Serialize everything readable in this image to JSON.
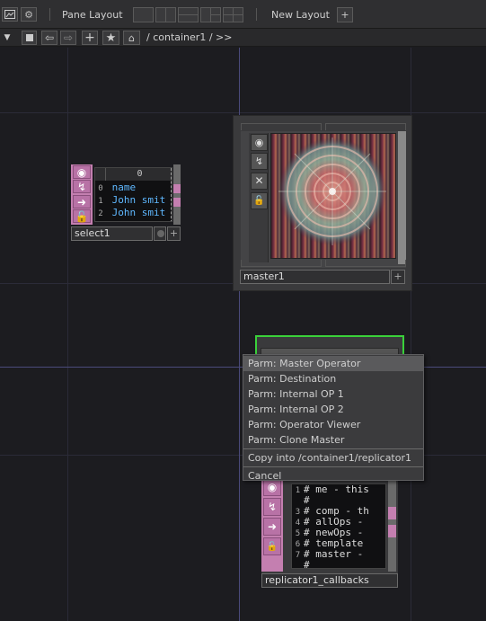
{
  "toolbar": {
    "pane_layout_label": "Pane Layout",
    "new_layout_label": "New Layout",
    "add_symbol": "+"
  },
  "pathbar": {
    "path_text": "/ container1 / >>"
  },
  "nodes": {
    "select1": {
      "name": "select1",
      "table": {
        "header": "0",
        "rows": [
          {
            "index": "0",
            "value": "name"
          },
          {
            "index": "1",
            "value": "John smit"
          },
          {
            "index": "2",
            "value": "John smit"
          }
        ]
      }
    },
    "master1": {
      "name": "master1"
    },
    "callbacks": {
      "name": "replicator1_callbacks",
      "lines": [
        {
          "num": "1",
          "text": "# me - this"
        },
        {
          "num": "",
          "text": "#"
        },
        {
          "num": "3",
          "text": "# comp - th"
        },
        {
          "num": "4",
          "text": "# allOps - "
        },
        {
          "num": "5",
          "text": "# newOps - "
        },
        {
          "num": "6",
          "text": "# template "
        },
        {
          "num": "7",
          "text": "# master - "
        },
        {
          "num": "",
          "text": "#"
        }
      ]
    }
  },
  "context_menu": {
    "items": [
      "Parm: Master Operator",
      "Parm: Destination",
      "Parm: Internal OP 1",
      "Parm: Internal OP 2",
      "Parm: Operator Viewer",
      "Parm: Clone Master"
    ],
    "copy_item": "Copy into /container1/replicator1",
    "cancel_item": "Cancel"
  },
  "colors": {
    "background": "#1c1c20",
    "node_pink": "#c47fb0",
    "selected_green": "#3ad13a",
    "table_text": "#5fb8ff"
  }
}
